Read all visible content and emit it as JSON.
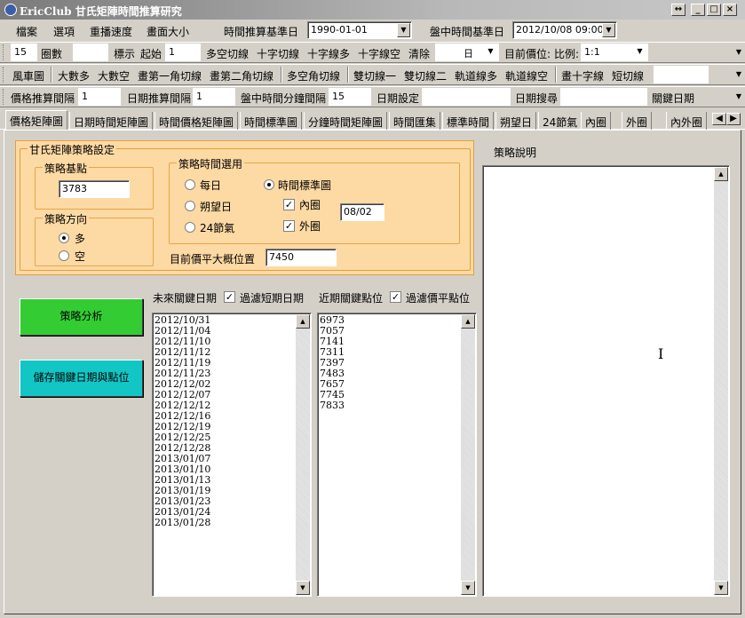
{
  "window": {
    "title": "EricClub 甘氏矩陣時間推算研究",
    "controls": [
      "↔",
      "_",
      "□",
      "×"
    ]
  },
  "menu": {
    "items": [
      "檔案",
      "選項",
      "重播速度",
      "畫面大小"
    ],
    "base_time_label": "時間推算基準日",
    "base_time_value": "1990-01-01",
    "mid_time_label": "盤中時間基準日",
    "mid_time_value": "2012/10/08 09:00"
  },
  "toolbar1": {
    "count_value": "15",
    "count_label": "圈數",
    "mark_value": "",
    "mark_label": "標示",
    "start_label": "起始",
    "start_value": "1",
    "buttons": [
      "多空切線",
      "十字切線",
      "十字線多",
      "十字線空",
      "清除"
    ],
    "clear_select": "日",
    "price_label": "目前價位:",
    "ratio_label": "比例:",
    "ratio_value": "1:1"
  },
  "toolbar2": {
    "buttons": [
      "風車圖",
      "大數多",
      "大數空",
      "畫第一角切線",
      "畫第二角切線",
      "多空角切線",
      "雙切線一",
      "雙切線二",
      "軌道線多",
      "軌道線空",
      "畫十字線",
      "短切線"
    ]
  },
  "toolbar3": {
    "price_interval_label": "價格推算間隔",
    "price_interval_value": "1",
    "date_interval_label": "日期推算間隔",
    "date_interval_value": "1",
    "mid_interval_label": "盤中時間分鐘間隔",
    "mid_interval_value": "15",
    "date_set_label": "日期設定",
    "date_search_label": "日期搜尋",
    "key_date_label": "關鍵日期"
  },
  "tabs": [
    "價格矩陣圖",
    "日期時間矩陣圖",
    "時間價格矩陣圖",
    "時間標準圖",
    "分鐘時間矩陣圖",
    "時間匯集",
    "標準時間",
    "朔望日",
    "24節氣",
    "內圈",
    "外圈",
    "內外圈"
  ],
  "strategy": {
    "panel_title": "甘氏矩陣策略設定",
    "base_group_title": "策略基點",
    "base_value": "3783",
    "direction_group_title": "策略方向",
    "direction_long": "多",
    "direction_short": "空",
    "time_group_title": "策略時間選用",
    "opt_daily": "每日",
    "opt_lunar": "朔望日",
    "opt_solar": "24節氣",
    "opt_time_std": "時間標準圖",
    "chk_inner": "內圈",
    "chk_outer": "外圈",
    "date_value": "08/02",
    "current_price_label": "目前價平大概位置",
    "current_price_value": "7450",
    "analyze_button": "策略分析",
    "save_button": "儲存關鍵日期與點位"
  },
  "future_dates": {
    "header": "未來關鍵日期",
    "filter_label": "過濾短期日期",
    "items": [
      "2012/10/31",
      "2012/11/04",
      "2012/11/10",
      "2012/11/12",
      "2012/11/19",
      "2012/11/23",
      "2012/12/02",
      "2012/12/07",
      "2012/12/12",
      "2012/12/16",
      "2012/12/19",
      "2012/12/25",
      "2012/12/28",
      "2013/01/07",
      "2013/01/10",
      "2013/01/13",
      "2013/01/19",
      "2013/01/23",
      "2013/01/24",
      "2013/01/28"
    ]
  },
  "key_prices": {
    "header": "近期關鍵點位",
    "filter_label": "過濾價平點位",
    "items": [
      "6973",
      "7057",
      "7141",
      "7311",
      "7397",
      "7483",
      "7657",
      "7745",
      "7833"
    ]
  },
  "description": {
    "header": "策略說明",
    "text": ""
  }
}
